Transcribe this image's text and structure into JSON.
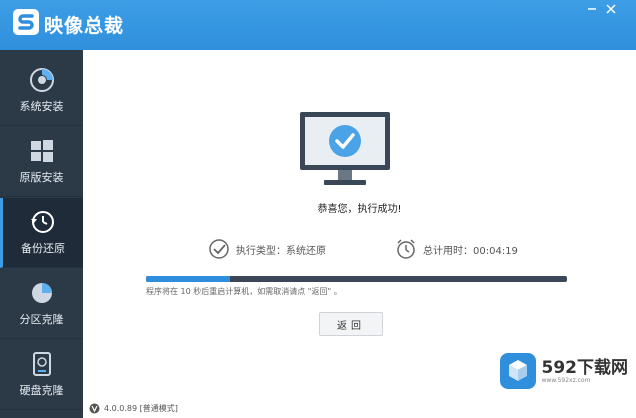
{
  "app": {
    "title": "映像总裁"
  },
  "sidebar": {
    "items": [
      {
        "label": "系统安装",
        "icon": "disk-install-icon"
      },
      {
        "label": "原版安装",
        "icon": "windows-logo-icon"
      },
      {
        "label": "备份还原",
        "icon": "backup-restore-icon",
        "active": true
      },
      {
        "label": "分区克隆",
        "icon": "pie-partition-icon"
      },
      {
        "label": "硬盘克隆",
        "icon": "hard-disk-icon"
      }
    ]
  },
  "main": {
    "success_message": "恭喜您，执行成功!",
    "task_type": "执行类型：系统还原",
    "time_used": "总计用时：00:04:19",
    "progress_percent": 20,
    "notice": "程序将在 10 秒后重启计算机，如需取消请点 \"返回\" 。",
    "return_label": "返回"
  },
  "statusbar": {
    "version": "4.0.0.89  [普通模式]"
  },
  "watermark": {
    "name": "592下载网",
    "url": "www.592xz.com"
  },
  "colors": {
    "accent": "#2f8fdc",
    "sidebar_bg": "#2c3a48"
  }
}
